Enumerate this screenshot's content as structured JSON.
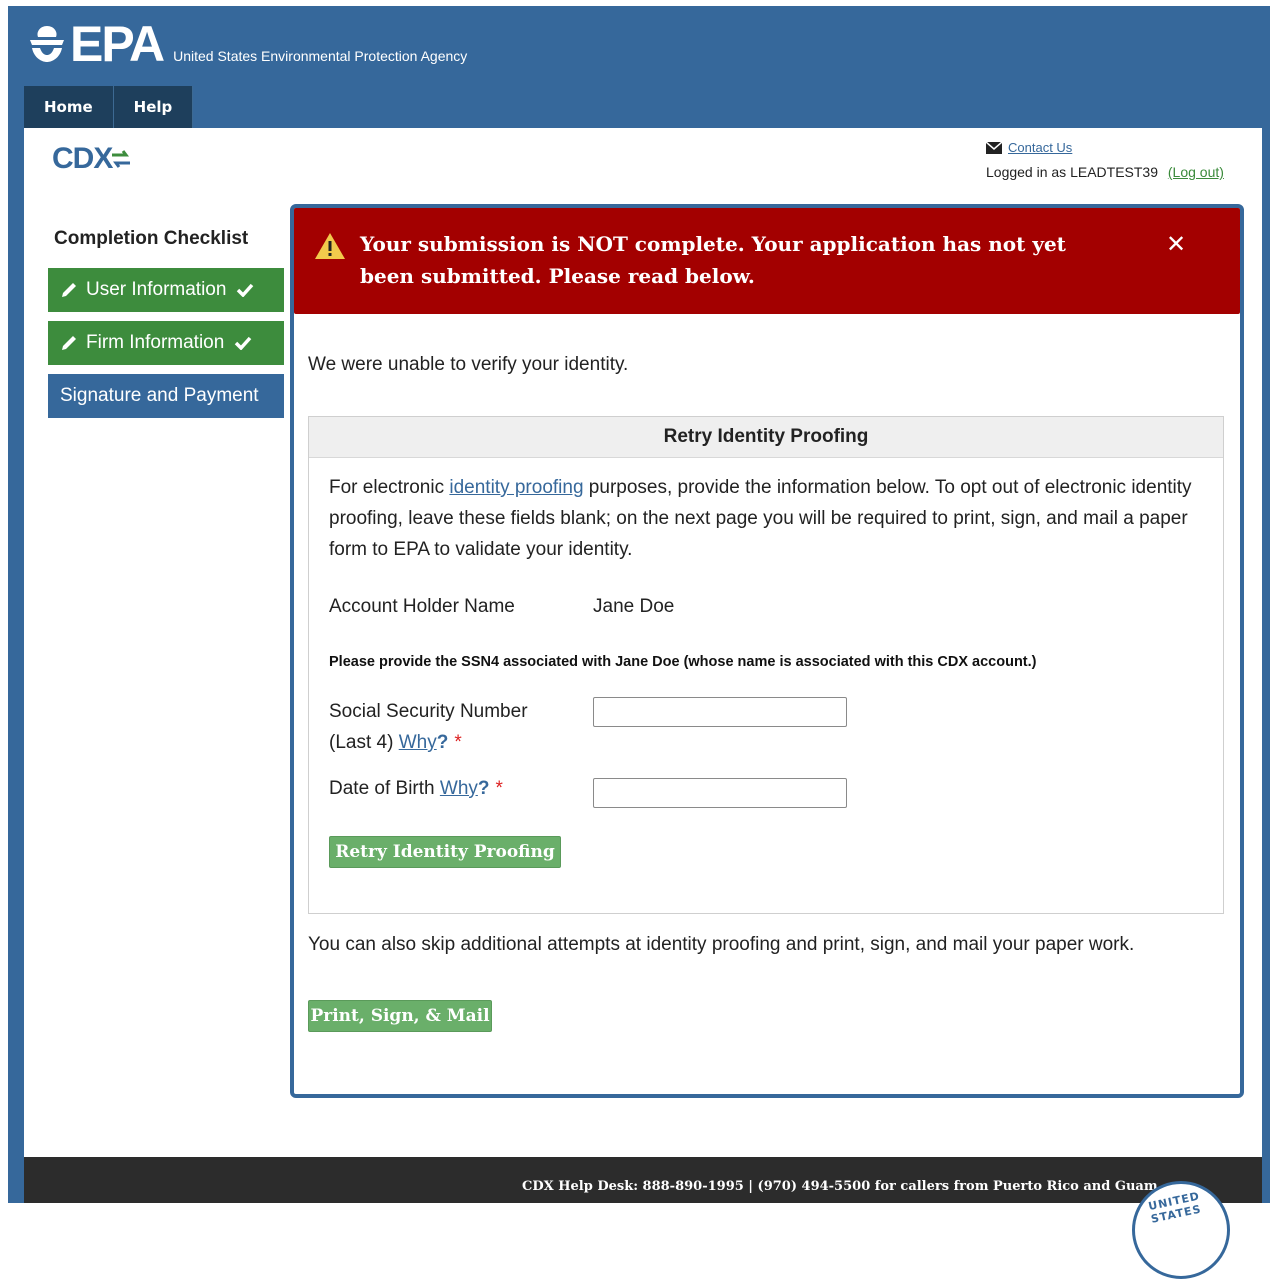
{
  "header": {
    "logo_text": "EPA",
    "agency_name": "United States Environmental Protection Agency"
  },
  "nav": {
    "home": "Home",
    "help": "Help"
  },
  "cdx_logo": "CDX",
  "contact_label": "Contact Us",
  "login": {
    "prefix": "Logged in as LEADTEST39",
    "logout": "(Log out)"
  },
  "checklist": {
    "title": "Completion Checklist",
    "items": [
      {
        "label": "User Information",
        "status": "complete"
      },
      {
        "label": "Firm Information",
        "status": "complete"
      },
      {
        "label": "Signature and Payment",
        "status": "current"
      }
    ]
  },
  "alert": {
    "message": "Your submission is NOT complete. Your application has not yet been submitted. Please read below.",
    "close_glyph": "✕"
  },
  "intro_text": "We were unable to verify your identity.",
  "retry": {
    "heading": "Retry Identity Proofing",
    "desc_prefix": "For electronic ",
    "desc_link": "identity proofing",
    "desc_suffix": " purposes, provide the information below. To opt out of electronic identity proofing, leave these fields blank; on the next page you will be required to print, sign, and mail a paper form to EPA to validate your identity.",
    "account_holder_label": "Account Holder Name",
    "account_holder_value": "Jane Doe",
    "ssn_note": "Please provide the SSN4 associated with Jane Doe (whose name is associated with this CDX account.)",
    "ssn_label_line1": "Social Security Number",
    "ssn_label_line2": "(Last 4)",
    "dob_label": "Date of Birth",
    "why": "Why",
    "q": "?",
    "required": "*",
    "ssn_value": "",
    "dob_value": "",
    "button": "Retry Identity Proofing"
  },
  "skip_text": "You can also skip additional attempts at identity proofing and print, sign, and mail your paper work.",
  "print_button": "Print, Sign, & Mail",
  "footer": {
    "help_desk": "CDX Help Desk: 888-890-1995 | (970) 494-5500 for callers from Puerto Rico and Guam",
    "seal_text": "UNITED STATES"
  },
  "colors": {
    "brand_blue": "#36689b",
    "nav_dark": "#1e3f5c",
    "alert_red": "#a30000",
    "success_green": "#3d8c3d",
    "button_green": "#6aaf6a"
  }
}
